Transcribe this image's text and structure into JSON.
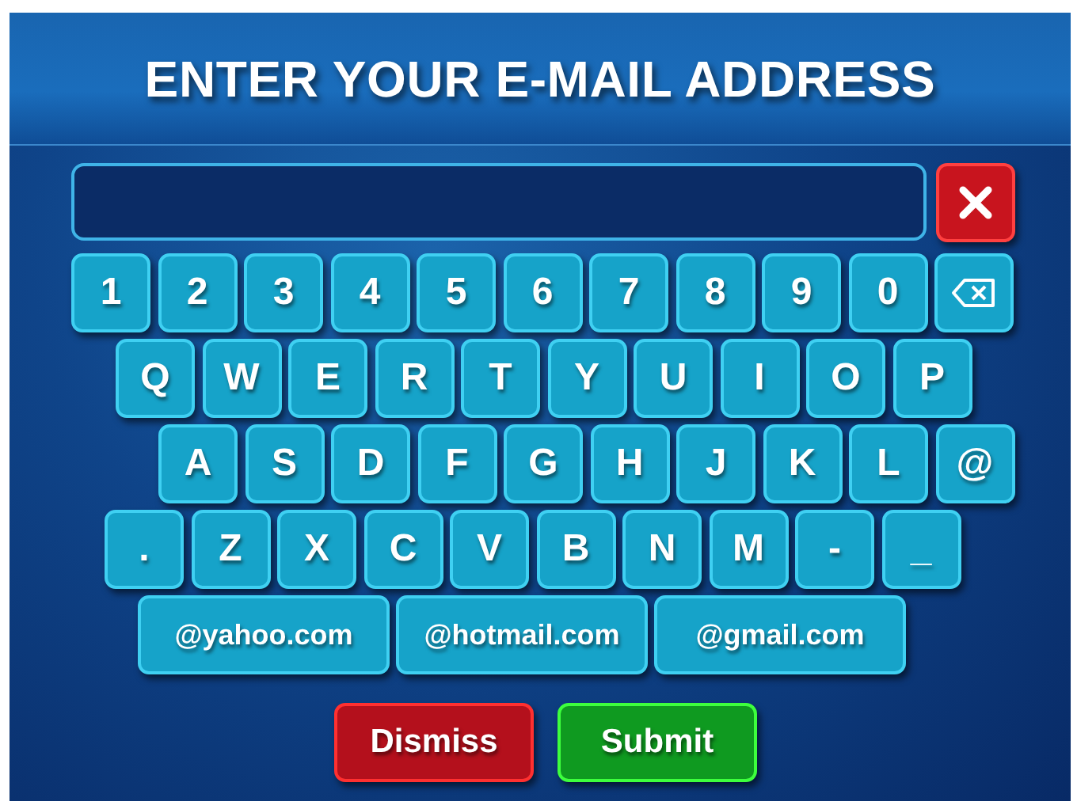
{
  "title": "ENTER YOUR E-MAIL ADDRESS",
  "keyboard_rows": [
    {
      "keys": [
        {
          "kind": "char",
          "label": "1"
        },
        {
          "kind": "char",
          "label": "2"
        },
        {
          "kind": "char",
          "label": "3"
        },
        {
          "kind": "char",
          "label": "4"
        },
        {
          "kind": "char",
          "label": "5"
        },
        {
          "kind": "char",
          "label": "6"
        },
        {
          "kind": "char",
          "label": "7"
        },
        {
          "kind": "char",
          "label": "8"
        },
        {
          "kind": "char",
          "label": "9"
        },
        {
          "kind": "char",
          "label": "0"
        },
        {
          "kind": "backspace"
        }
      ]
    },
    {
      "keys": [
        {
          "kind": "char",
          "label": "Q"
        },
        {
          "kind": "char",
          "label": "W"
        },
        {
          "kind": "char",
          "label": "E"
        },
        {
          "kind": "char",
          "label": "R"
        },
        {
          "kind": "char",
          "label": "T"
        },
        {
          "kind": "char",
          "label": "Y"
        },
        {
          "kind": "char",
          "label": "U"
        },
        {
          "kind": "char",
          "label": "I"
        },
        {
          "kind": "char",
          "label": "O"
        },
        {
          "kind": "char",
          "label": "P"
        }
      ]
    },
    {
      "keys": [
        {
          "kind": "char",
          "label": "A"
        },
        {
          "kind": "char",
          "label": "S"
        },
        {
          "kind": "char",
          "label": "D"
        },
        {
          "kind": "char",
          "label": "F"
        },
        {
          "kind": "char",
          "label": "G"
        },
        {
          "kind": "char",
          "label": "H"
        },
        {
          "kind": "char",
          "label": "J"
        },
        {
          "kind": "char",
          "label": "K"
        },
        {
          "kind": "char",
          "label": "L"
        },
        {
          "kind": "char",
          "label": "@"
        }
      ]
    },
    {
      "keys": [
        {
          "kind": "char",
          "label": "."
        },
        {
          "kind": "char",
          "label": "Z"
        },
        {
          "kind": "char",
          "label": "X"
        },
        {
          "kind": "char",
          "label": "C"
        },
        {
          "kind": "char",
          "label": "V"
        },
        {
          "kind": "char",
          "label": "B"
        },
        {
          "kind": "char",
          "label": "N"
        },
        {
          "kind": "char",
          "label": "M"
        },
        {
          "kind": "char",
          "label": "-"
        },
        {
          "kind": "char",
          "label": "_"
        }
      ]
    }
  ],
  "domain_keys": [
    "@yahoo.com",
    "@hotmail.com",
    "@gmail.com"
  ],
  "actions": [
    {
      "kind": "dismiss",
      "label": "Dismiss"
    },
    {
      "kind": "submit",
      "label": "Submit"
    }
  ]
}
